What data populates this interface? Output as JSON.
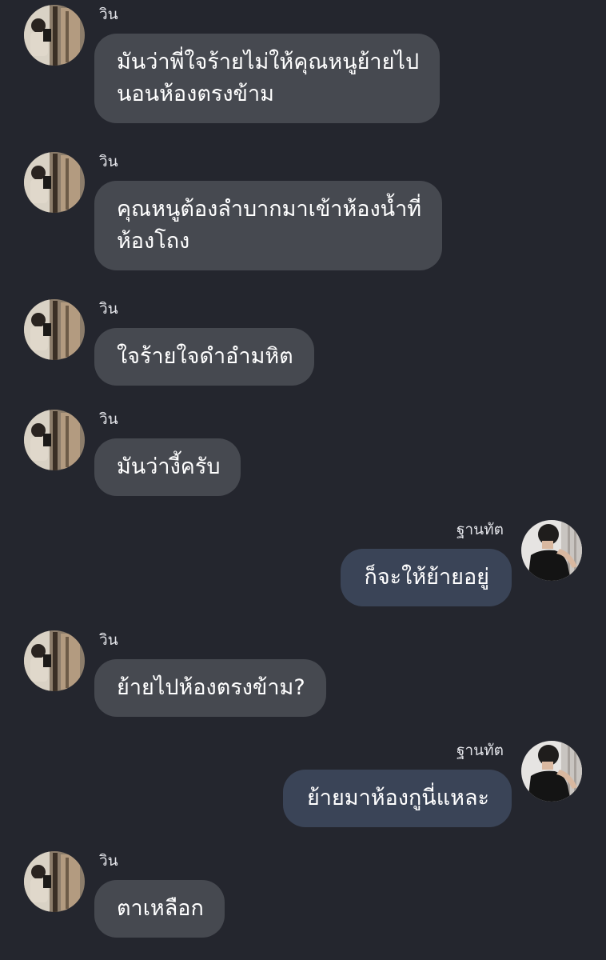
{
  "participants": {
    "win": {
      "name": "วิน"
    },
    "thanat": {
      "name": "ฐานทัต"
    }
  },
  "messages": [
    {
      "from": "win",
      "direction": "incoming",
      "lines": [
        "มันว่าพี่ใจร้ายไม่ให้คุณหนูย้ายไป",
        "นอนห้องตรงข้าม"
      ]
    },
    {
      "from": "win",
      "direction": "incoming",
      "lines": [
        "คุณหนูต้องลำบากมาเข้าห้องน้ำที่",
        "ห้องโถง"
      ]
    },
    {
      "from": "win",
      "direction": "incoming",
      "lines": [
        "ใจร้ายใจดำอำมหิต"
      ]
    },
    {
      "from": "win",
      "direction": "incoming",
      "lines": [
        "มันว่างี้ครับ"
      ]
    },
    {
      "from": "thanat",
      "direction": "outgoing",
      "lines": [
        "ก็จะให้ย้ายอยู่"
      ]
    },
    {
      "from": "win",
      "direction": "incoming",
      "lines": [
        "ย้ายไปห้องตรงข้าม?"
      ]
    },
    {
      "from": "thanat",
      "direction": "outgoing",
      "lines": [
        "ย้ายมาห้องกูนี่แหละ"
      ]
    },
    {
      "from": "win",
      "direction": "incoming",
      "lines": [
        "ตาเหลือก"
      ]
    }
  ],
  "theme": {
    "background": "#24262e",
    "incoming_bubble": "#464950",
    "outgoing_bubble": "#3a4457",
    "text": "#ffffff",
    "sender_text": "#e2e3e8"
  },
  "icons": {
    "win_avatar": "avatar-mirror-selfie-icon",
    "thanat_avatar": "avatar-tank-top-icon"
  }
}
